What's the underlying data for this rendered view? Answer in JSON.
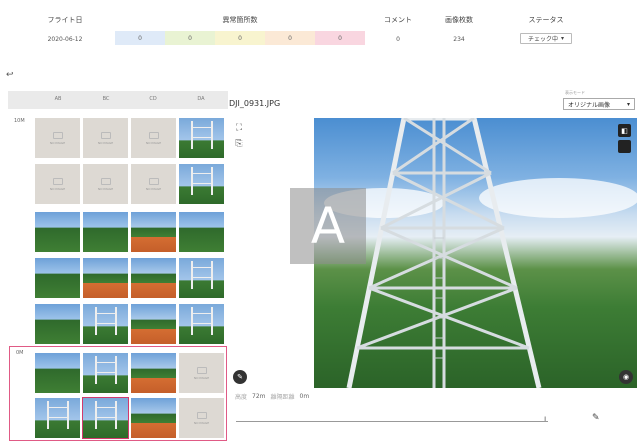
{
  "header": {
    "flight_date_label": "フライト日",
    "anomaly_label": "異常箇所数",
    "comment_label": "コメント",
    "image_count_label": "画像枚数",
    "status_label": "ステータス",
    "flight_date": "2020-06-12",
    "anomaly_counts": [
      {
        "value": "0",
        "color": "#dfeaf8"
      },
      {
        "value": "0",
        "color": "#e9f3d3"
      },
      {
        "value": "0",
        "color": "#f8f4cf"
      },
      {
        "value": "0",
        "color": "#fbe9d6"
      },
      {
        "value": "0",
        "color": "#f9d6e0"
      }
    ],
    "comment_count": "0",
    "image_count": "234",
    "status_value": "チェック中"
  },
  "thumb_panel": {
    "columns": [
      "AB",
      "BC",
      "CD",
      "DA"
    ],
    "row_labels": [
      "10M",
      "0M"
    ],
    "placeholder_text": "NO IMAGE"
  },
  "viewer": {
    "file_name": "DJI_0931.JPG",
    "display_label": "表示モード",
    "display_mode": "オリジナル画像",
    "overlay_letter": "A",
    "altitude_label": "高度",
    "altitude_value": "72m",
    "distance_label": "離隔距離",
    "distance_value": "0m"
  },
  "icons": {
    "back": "back-arrow-icon",
    "expand": "expand-icon",
    "image_swap": "image-swap-icon",
    "comment": "comment-icon",
    "location": "location-icon",
    "camera": "camera-icon",
    "pencil": "pencil-icon"
  }
}
